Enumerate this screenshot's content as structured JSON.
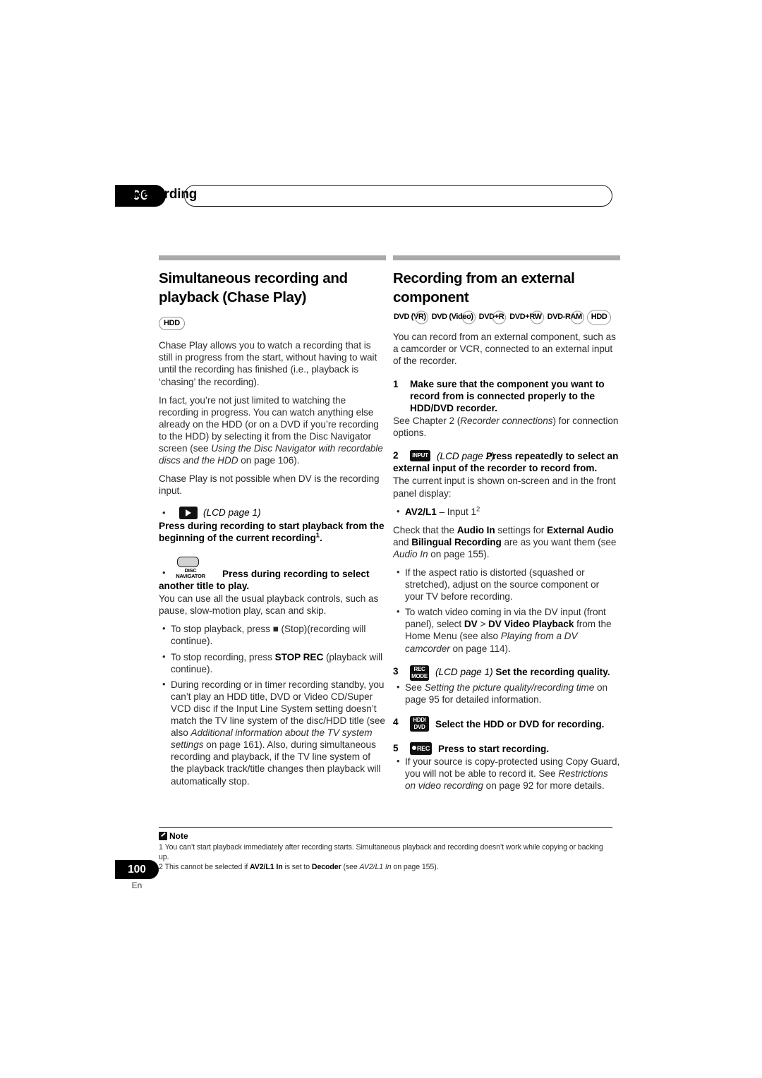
{
  "header": {
    "chapter_number": "06",
    "chapter_title": "Recording"
  },
  "left_column": {
    "section_title": "Simultaneous recording and playback (Chase Play)",
    "badge": "HDD",
    "paragraphs": [
      "Chase Play allows you to watch a recording that is still in progress from the start, without having to wait until the recording has finished (i.e., playback is ‘chasing’ the recording).",
      "Chase Play is not possible when DV is the recording input."
    ],
    "paragraph2_parts": {
      "a": "In fact, you’re not just limited to watching the recording in progress. You can watch anything else already on the HDD (or on a DVD if you’re recording to the HDD) by selecting it from the Disc Navigator screen (see ",
      "italic": "Using the Disc Navigator with recordable discs and the HDD",
      "b": " on page 106)."
    },
    "press_play": {
      "bullet": "•",
      "icon_name": "play-key",
      "lcd_note": "(LCD page 1)",
      "text_a": " Press during recording to start playback from the beginning of the current recording",
      "footnote": "1",
      "text_b": "."
    },
    "disc_navigator": {
      "bullet": "•",
      "key_label_line1": "DISC",
      "key_label_line2": "NAVIGATOR",
      "text": "Press during recording to select another title to play.",
      "follow_up": "You can use all the usual playback controls, such as pause, slow-motion play, scan and skip."
    },
    "bullets": [
      {
        "a": "To stop playback, press ",
        "glyph": "■",
        "b": " (Stop)(recording will continue)."
      },
      {
        "a": "To stop recording, press ",
        "bold": "STOP REC",
        "b": " (playback will continue)."
      },
      {
        "a": "During recording or in timer recording standby, you can’t play an HDD title, DVD or Video CD/Super VCD disc if the Input Line System setting doesn’t match the TV line system of the disc/HDD title (see also ",
        "italic": "Additional information about the TV system settings",
        "b": " on page 161). Also, during simultaneous recording and playback, if the TV line system of the playback track/title changes then playback will automatically stop."
      }
    ]
  },
  "right_column": {
    "section_title": "Recording from an external component",
    "disc_badges": [
      "DVD (VR)",
      "DVD (Video)",
      "DVD+R",
      "DVD+RW",
      "DVD-RAM",
      "HDD"
    ],
    "intro": "You can record from an external component, such as a camcorder or VCR, connected to an external input of the recorder.",
    "step1": {
      "number": "1",
      "title": "Make sure that the component you want to record from is connected properly to the HDD/DVD recorder.",
      "body_a": "See Chapter 2 (",
      "body_italic": "Recorder connections",
      "body_b": ") for connection options."
    },
    "step2": {
      "number": "2",
      "icon_label": "INPUT",
      "lcd_note": "(LCD page 2)",
      "title": " Press repeatedly to select an external input of the recorder to record from.",
      "body": "The current input is shown on-screen and in the front panel display:",
      "input_bullet": {
        "bold": "AV2/L1",
        "rest": " – Input 1",
        "footnote": "2"
      },
      "check_a": "Check that the ",
      "check_b1": "Audio In",
      "check_c": " settings for ",
      "check_b2": "External Audio",
      "check_d": " and ",
      "check_b3": "Bilingual Recording",
      "check_e": " are as you want them (see ",
      "check_italic": "Audio In",
      "check_f": " on page 155)."
    },
    "step2_bullets": [
      {
        "text": "If the aspect ratio is distorted (squashed or stretched), adjust on the source component or your TV before recording."
      },
      {
        "a": "To watch video coming in via the DV input (front panel), select ",
        "bold1": "DV",
        "mid": " > ",
        "bold2": "DV Video Playback",
        "b": " from the Home Menu (see also ",
        "italic": "Playing from a DV camcorder",
        "c": " on page 114)."
      }
    ],
    "step3": {
      "number": "3",
      "icon_line1": "REC",
      "icon_line2": "MODE",
      "lcd_note": "(LCD page 1)",
      "title": " Set the recording quality.",
      "bullet_a": "See ",
      "bullet_italic": "Setting the picture quality/recording time",
      "bullet_b": " on page 95 for detailed information."
    },
    "step4": {
      "number": "4",
      "icon_line1": "HDD/",
      "icon_line2": "DVD",
      "title": "Select the HDD or DVD for recording."
    },
    "step5": {
      "number": "5",
      "icon_label": "REC",
      "title": "Press to start recording.",
      "bullet_a": "If your source is copy-protected using Copy Guard, you will not be able to record it. See ",
      "bullet_italic": "Restrictions on video recording",
      "bullet_b": " on page 92 for more details."
    }
  },
  "footer": {
    "note_title": "Note",
    "note1": {
      "num": "1",
      "text": "You can’t start playback immediately after recording starts. Simultaneous playback and recording doesn’t work while copying or backing up."
    },
    "note2": {
      "num": "2",
      "a": "This cannot be selected if ",
      "bold1": "AV2/L1 In",
      "b": " is set to ",
      "bold2": "Decoder",
      "c": " (see ",
      "italic": "AV2/L1 In",
      "d": " on page 155)."
    },
    "page_number": "100",
    "language": "En"
  }
}
